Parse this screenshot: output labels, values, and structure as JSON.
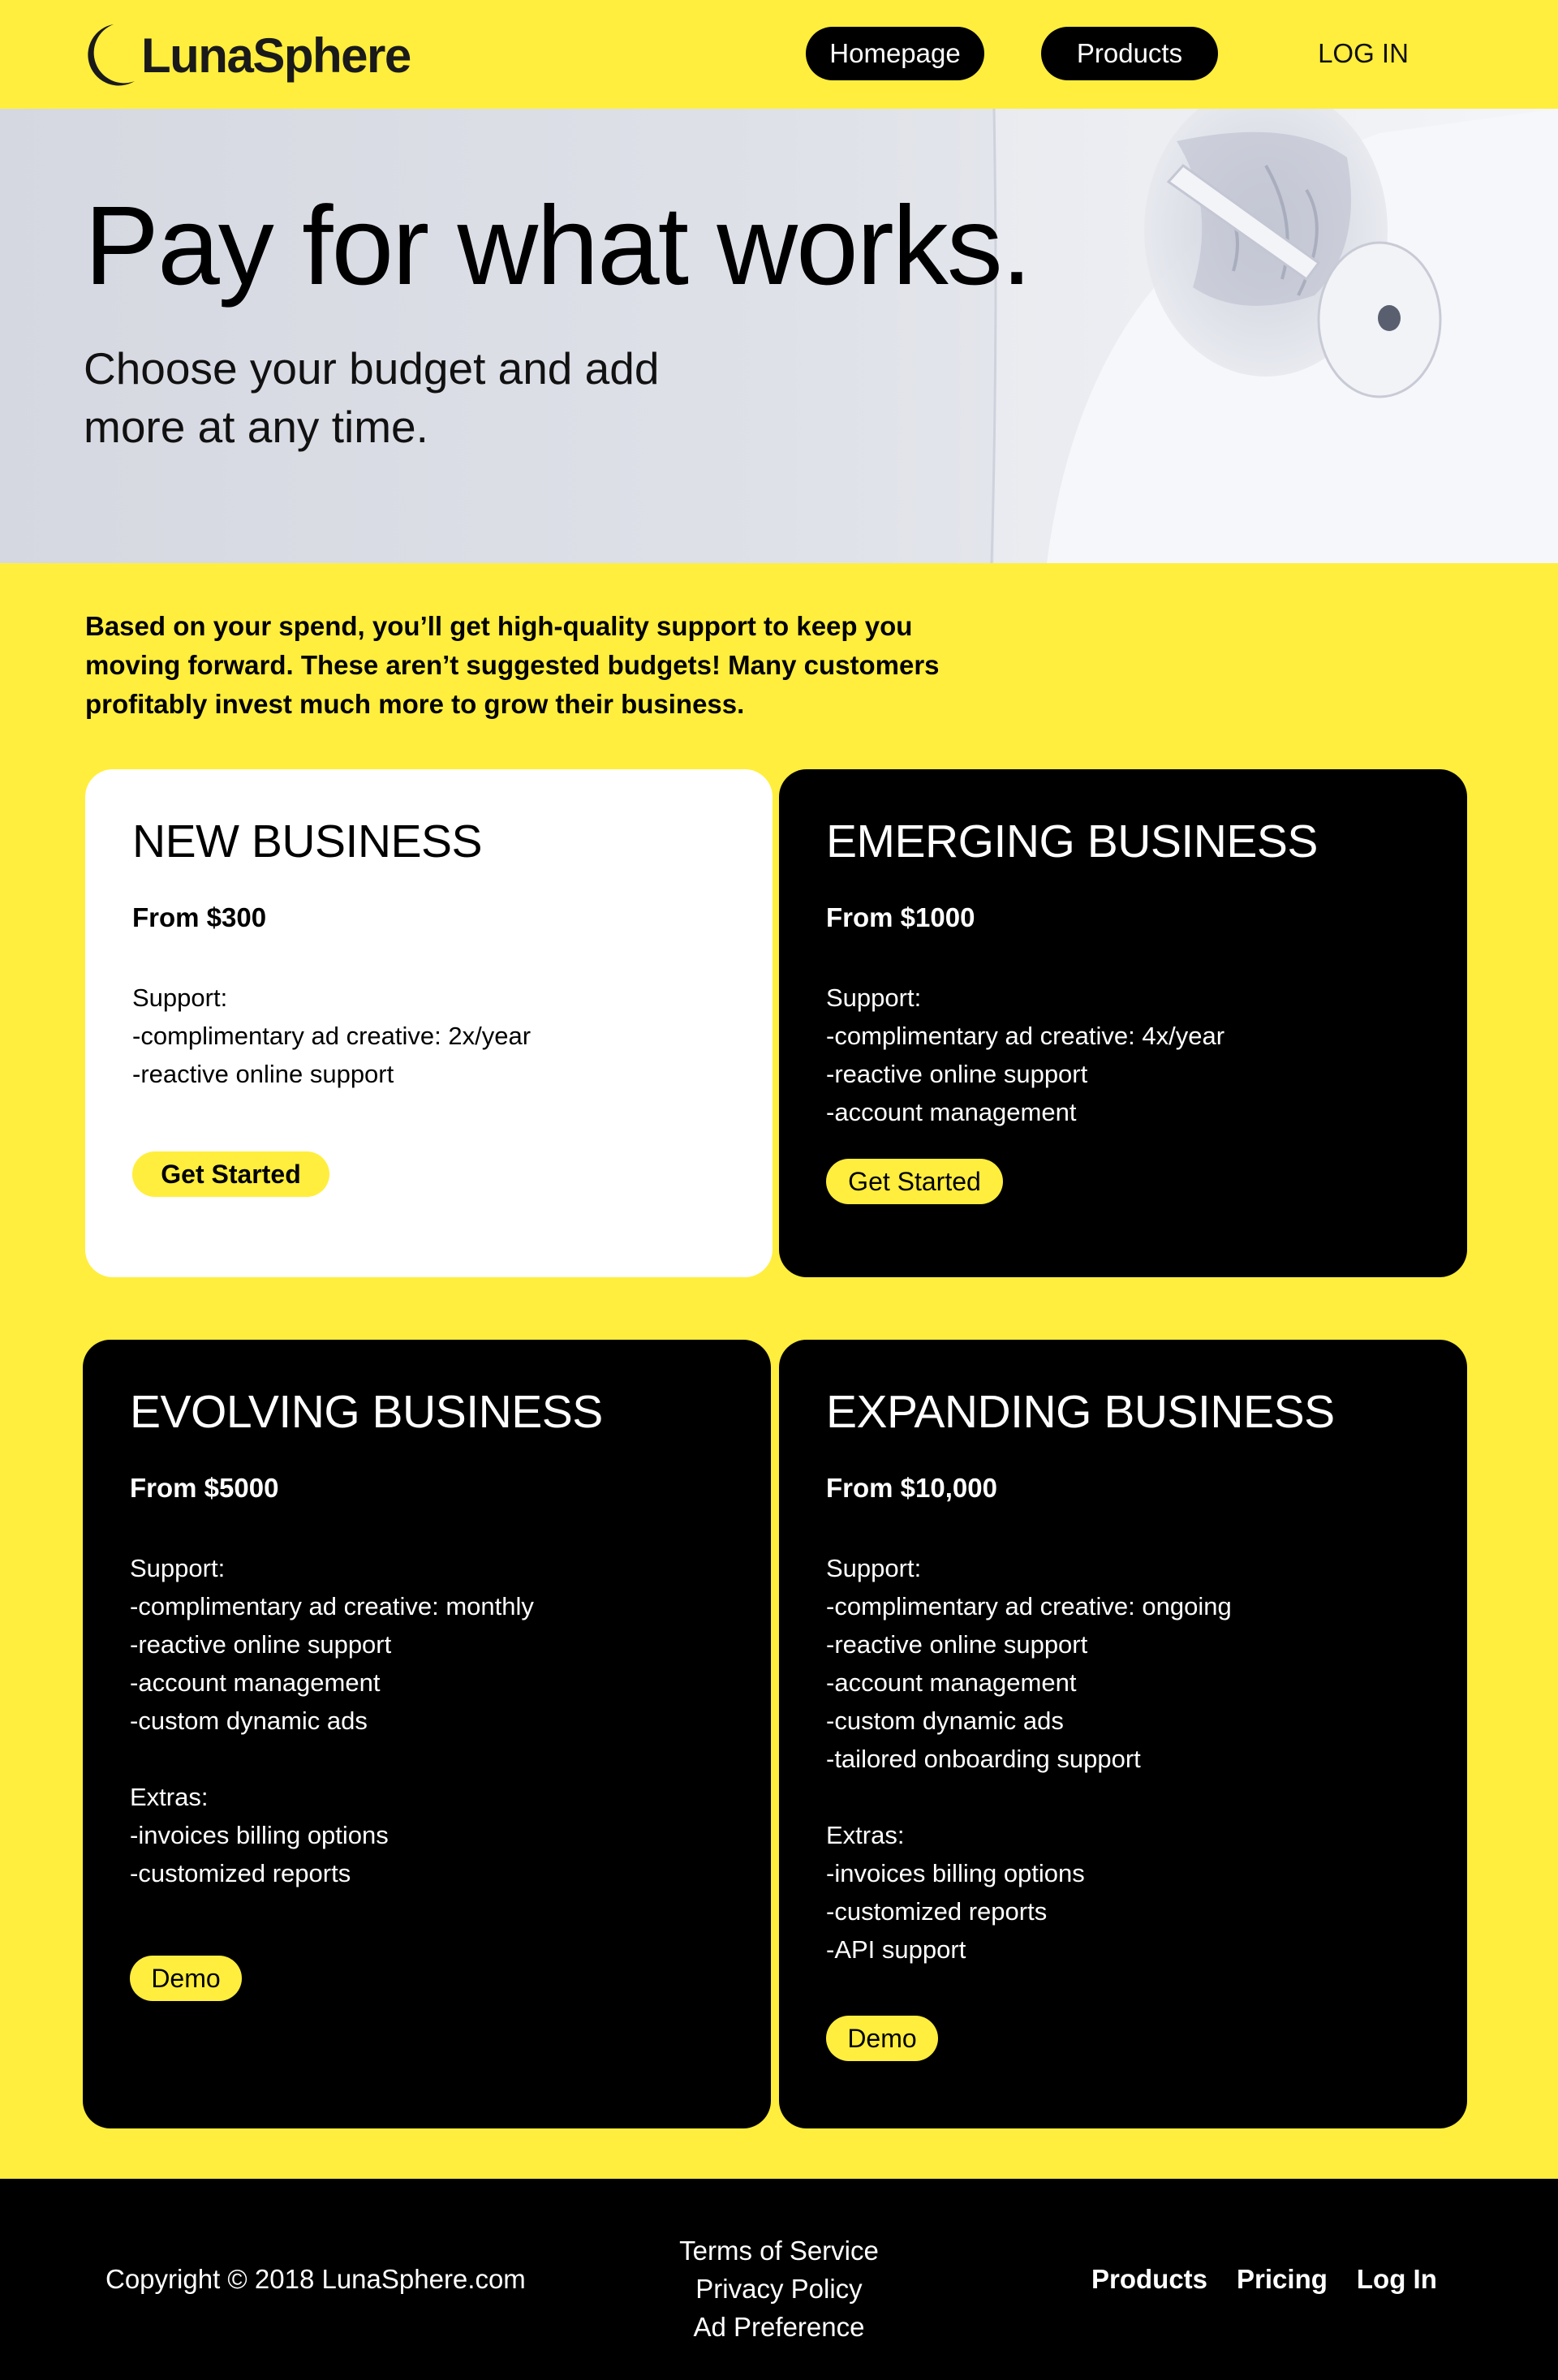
{
  "brand": {
    "name": "LunaSphere",
    "accent": "#FFEE3D",
    "dark": "#000000"
  },
  "nav": {
    "home": "Homepage",
    "products": "Products",
    "login": "LOG IN"
  },
  "hero": {
    "title": "Pay for what works.",
    "subtitle_line1": "Choose your budget and add",
    "subtitle_line2": "more at any time."
  },
  "intro": {
    "line1": "Based on your spend, you’ll get high-quality support to keep you",
    "line2": "moving forward. These aren’t suggested budgets! Many customers",
    "line3": "profitably invest much more to grow their business."
  },
  "plans": [
    {
      "title": "NEW BUSINESS",
      "price": "From $300",
      "support_label": "Support:",
      "support": [
        "-complimentary ad creative: 2x/year",
        "-reactive online support"
      ],
      "button": "Get Started"
    },
    {
      "title": "EMERGING BUSINESS",
      "price": "From $1000",
      "support_label": "Support:",
      "support": [
        "-complimentary ad creative: 4x/year",
        "-reactive online support",
        "-account management"
      ],
      "button": "Get Started"
    },
    {
      "title": "EVOLVING BUSINESS",
      "price": "From $5000",
      "support_label": "Support:",
      "support": [
        "-complimentary ad creative: monthly",
        "-reactive online support",
        "-account management",
        "-custom dynamic ads"
      ],
      "extras_label": "Extras:",
      "extras": [
        "-invoices billing options",
        "-customized reports"
      ],
      "button": "Demo"
    },
    {
      "title": "EXPANDING BUSINESS",
      "price": "From $10,000",
      "support_label": "Support:",
      "support": [
        "-complimentary ad creative: ongoing",
        "-reactive online support",
        "-account management",
        "-custom dynamic ads",
        "-tailored onboarding support"
      ],
      "extras_label": "Extras:",
      "extras": [
        "-invoices billing options",
        "-customized reports",
        "-API support"
      ],
      "button": "Demo"
    }
  ],
  "footer": {
    "copyright": "Copyright © 2018 LunaSphere.com",
    "legal": [
      "Terms of Service",
      "Privacy Policy",
      "Ad Preference"
    ],
    "links": [
      "Products",
      "Pricing",
      "Log In"
    ]
  }
}
